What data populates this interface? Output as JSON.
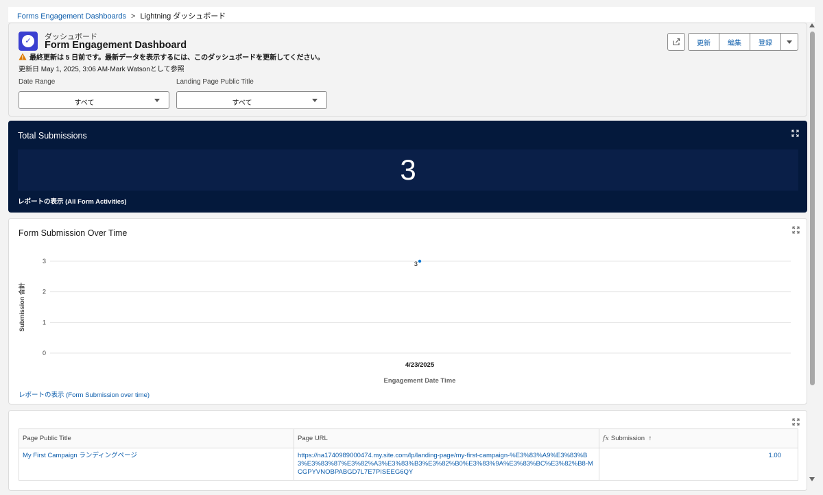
{
  "breadcrumb": {
    "parent": "Forms Engagement Dashboards",
    "separator": ">",
    "current": "Lightning ダッシュボード"
  },
  "header": {
    "object_label": "ダッシュボード",
    "title": "Form Engagement Dashboard",
    "warning": "最終更新は 5 日前です。最新データを表示するには、このダッシュボードを更新してください。",
    "updated": "更新日 May 1, 2025, 3:06 AM·Mark Watsonとして参照"
  },
  "toolbar": {
    "refresh_label": "更新",
    "edit_label": "編集",
    "subscribe_label": "登録",
    "share_icon": "share-icon",
    "more_icon": "chevron-down-icon"
  },
  "filters": [
    {
      "label": "Date Range",
      "value": "すべて"
    },
    {
      "label": "Landing Page Public Title",
      "value": "すべて"
    }
  ],
  "total_card": {
    "title": "Total Submissions",
    "value": "3",
    "link": "レポートの表示 (All Form Activities)"
  },
  "chart_card": {
    "title": "Form Submission Over Time",
    "link": "レポートの表示 (Form Submission over time)"
  },
  "chart_data": {
    "type": "scatter",
    "title": "Form Submission Over Time",
    "xlabel": "Engagement Date Time",
    "ylabel": "Submission 合計",
    "categories": [
      "4/23/2025"
    ],
    "values": [
      3
    ],
    "data_labels": [
      "3"
    ],
    "yticks": [
      "0",
      "1",
      "2",
      "3"
    ],
    "ylim": [
      0,
      3
    ],
    "grid": true
  },
  "table": {
    "headers": [
      "Page Public Title",
      "Page URL",
      "Submission"
    ],
    "sort_indicator": "↑",
    "fx_label": "fx",
    "rows": [
      {
        "title": "My First Campaign ランディングページ",
        "url": "https://na1740989000474.my.site.com/lp/landing-page/my-first-campaign-%E3%83%A9%E3%83%B3%E3%83%87%E3%82%A3%E3%83%B3%E3%82%B0%E3%83%9A%E3%83%BC%E3%82%B8-MCGPYVNOBPABGD7L7E7PISEEG6QY",
        "submission": "1.00"
      }
    ]
  },
  "colors": {
    "brand_blue": "#0b5cab",
    "total_card_bg": "#04193c",
    "point_color": "#0176d3",
    "app_icon": "#3a3fd0"
  }
}
